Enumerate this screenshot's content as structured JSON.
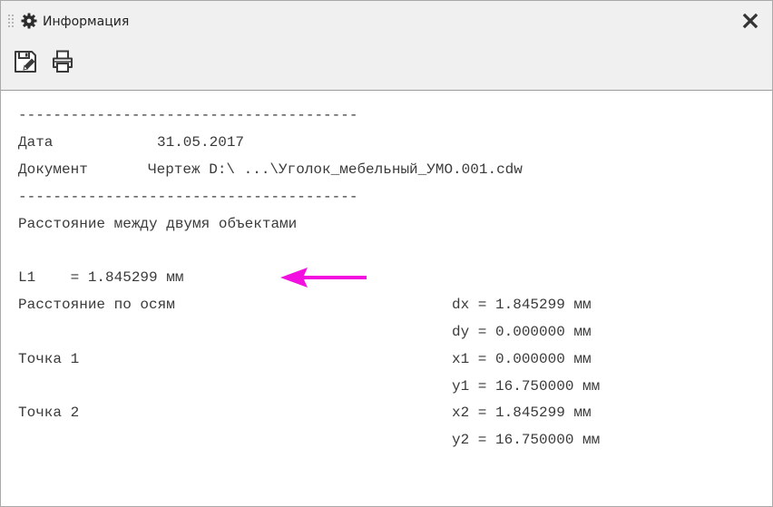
{
  "window": {
    "title": "Информация",
    "close_label": "X"
  },
  "toolbar": {
    "icons": [
      "save-icon",
      "print-icon"
    ]
  },
  "report": {
    "separator": "---------------------------------------",
    "date_label": "Дата",
    "date_value": "31.05.2017",
    "document_label": "Документ",
    "document_value": "Чертеж D:\\ ...\\Уголок_мебельный_УМО.001.cdw",
    "heading": "Расстояние между двумя объектами",
    "l1": "L1    = 1.845299 мм",
    "axes_label": "Расстояние по осям",
    "dx": "dx = 1.845299 мм",
    "dy": "dy = 0.000000 мм",
    "point1_label": "Точка 1",
    "x1": "x1 = 0.000000 мм",
    "y1": "y1 = 16.750000 мм",
    "point2_label": "Точка 2",
    "x2": "x2 = 1.845299 мм",
    "y2": "y2 = 16.750000 мм"
  },
  "annotation": {
    "arrow_color": "#f20fe0"
  }
}
